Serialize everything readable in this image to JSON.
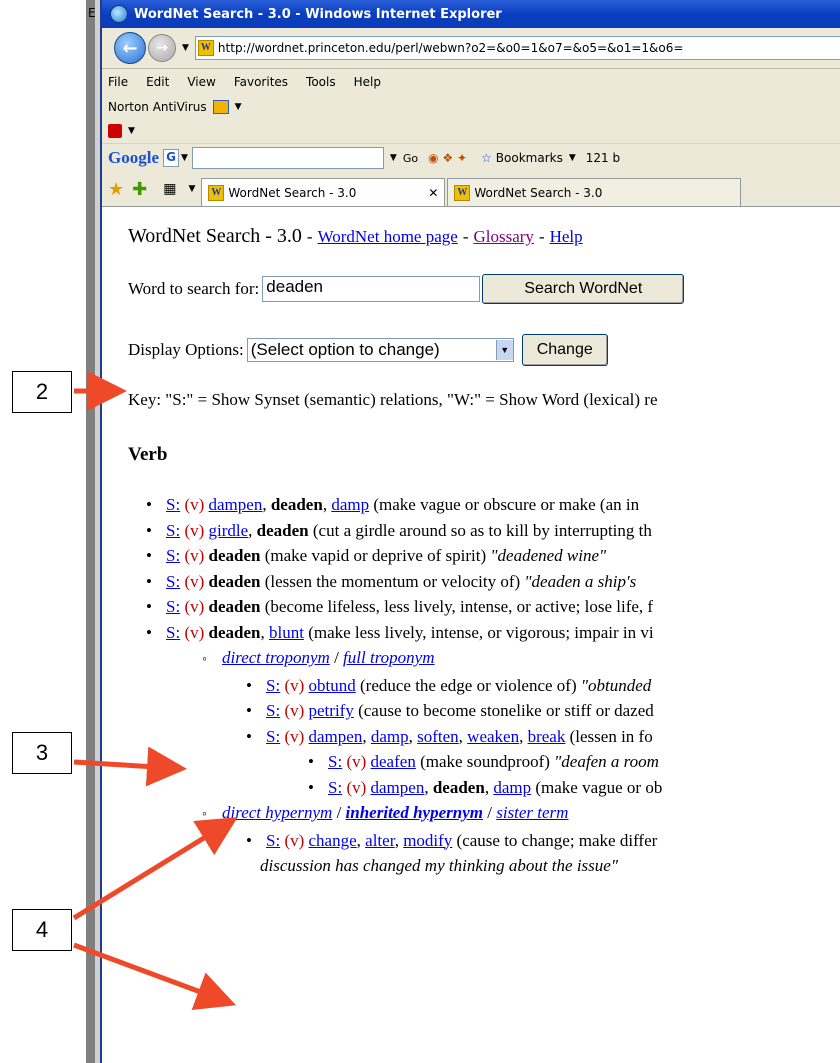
{
  "window": {
    "title": "WordNet Search - 3.0 - Windows Internet Explorer"
  },
  "address": {
    "url": "http://wordnet.princeton.edu/perl/webwn?o2=&o0=1&o7=&o5=&o1=1&o6="
  },
  "menu": [
    "File",
    "Edit",
    "View",
    "Favorites",
    "Tools",
    "Help"
  ],
  "norton": {
    "label": "Norton AntiVirus"
  },
  "google_toolbar": {
    "logo": "Google",
    "go": "Go",
    "bookmarks": "Bookmarks",
    "blocked": "121 b"
  },
  "tabs": [
    {
      "label": "WordNet Search - 3.0"
    },
    {
      "label": "WordNet Search - 3.0"
    }
  ],
  "page": {
    "title": "WordNet Search - 3.0",
    "sep": "-",
    "links": [
      "WordNet home page",
      "Glossary",
      "Help"
    ],
    "search_label": "Word to search for:",
    "search_value": "deaden",
    "search_button": "Search WordNet",
    "display_label": "Display Options:",
    "display_value": "(Select option to change)",
    "change_button": "Change",
    "key_text": "Key: \"S:\" = Show Synset (semantic) relations, \"W:\" = Show Word (lexical) re",
    "section": "Verb"
  },
  "entries": [
    {
      "s": "S:",
      "v": "(v)",
      "parts": [
        [
          "a",
          "dampen"
        ],
        [
          "t",
          ", "
        ],
        [
          "b",
          "deaden"
        ],
        [
          "t",
          ", "
        ],
        [
          "a",
          "damp"
        ],
        [
          "t",
          " (make vague or obscure or make (an in"
        ]
      ]
    },
    {
      "s": "S:",
      "v": "(v)",
      "parts": [
        [
          "a",
          "girdle"
        ],
        [
          "t",
          ", "
        ],
        [
          "b",
          "deaden"
        ],
        [
          "t",
          " (cut a girdle around so as to kill by interrupting th"
        ]
      ]
    },
    {
      "s": "S:",
      "v": "(v)",
      "parts": [
        [
          "b",
          "deaden"
        ],
        [
          "t",
          " (make vapid or deprive of spirit) "
        ],
        [
          "i",
          "\"deadened wine\""
        ]
      ]
    },
    {
      "s": "S:",
      "v": "(v)",
      "parts": [
        [
          "b",
          "deaden"
        ],
        [
          "t",
          " (lessen the momentum or velocity of) "
        ],
        [
          "i",
          "\"deaden a ship's"
        ]
      ]
    },
    {
      "s": "S:",
      "v": "(v)",
      "parts": [
        [
          "b",
          "deaden"
        ],
        [
          "t",
          " (become lifeless, less lively, intense, or active; lose life, f"
        ]
      ]
    },
    {
      "s": "S:",
      "v": "(v)",
      "parts": [
        [
          "b",
          "deaden"
        ],
        [
          "t",
          ", "
        ],
        [
          "a",
          "blunt"
        ],
        [
          "t",
          " (make less lively, intense, or vigorous; impair in vi"
        ]
      ]
    }
  ],
  "troponym": {
    "direct": "direct troponym",
    "slash": " / ",
    "full": "full troponym"
  },
  "sub_entries": [
    {
      "s": "S:",
      "v": "(v)",
      "parts": [
        [
          "a",
          "obtund"
        ],
        [
          "t",
          " (reduce the edge or violence of) "
        ],
        [
          "i",
          "\"obtunded"
        ]
      ]
    },
    {
      "s": "S:",
      "v": "(v)",
      "parts": [
        [
          "a",
          "petrify"
        ],
        [
          "t",
          " (cause to become stonelike or stiff or dazed"
        ]
      ]
    },
    {
      "s": "S:",
      "v": "(v)",
      "parts": [
        [
          "a",
          "dampen"
        ],
        [
          "t",
          ", "
        ],
        [
          "a",
          "damp"
        ],
        [
          "t",
          ", "
        ],
        [
          "a",
          "soften"
        ],
        [
          "t",
          ", "
        ],
        [
          "a",
          "weaken"
        ],
        [
          "t",
          ", "
        ],
        [
          "a",
          "break"
        ],
        [
          "t",
          " (lessen in fo"
        ]
      ]
    }
  ],
  "sub_sub_entries": [
    {
      "s": "S:",
      "v": "(v)",
      "parts": [
        [
          "a",
          "deafen"
        ],
        [
          "t",
          " (make soundproof) "
        ],
        [
          "i",
          "\"deafen a room"
        ]
      ]
    },
    {
      "s": "S:",
      "v": "(v)",
      "parts": [
        [
          "a",
          "dampen"
        ],
        [
          "t",
          ", "
        ],
        [
          "b",
          "deaden"
        ],
        [
          "t",
          ", "
        ],
        [
          "a",
          "damp"
        ],
        [
          "t",
          " (make vague or ob"
        ]
      ]
    }
  ],
  "hypernym": {
    "direct": "direct hypernym",
    "inherited": "inherited hypernym",
    "sister": "sister term",
    "slash": " / "
  },
  "hyp_entries": [
    {
      "s": "S:",
      "v": "(v)",
      "parts": [
        [
          "a",
          "change"
        ],
        [
          "t",
          ", "
        ],
        [
          "a",
          "alter"
        ],
        [
          "t",
          ", "
        ],
        [
          "a",
          "modify"
        ],
        [
          "t",
          " (cause to change; make differ"
        ]
      ]
    }
  ],
  "last_line": "discussion has changed my thinking about the issue\"",
  "callouts": {
    "c2": "2",
    "c3": "3",
    "c4": "4"
  },
  "peek": {
    "top": "E"
  }
}
